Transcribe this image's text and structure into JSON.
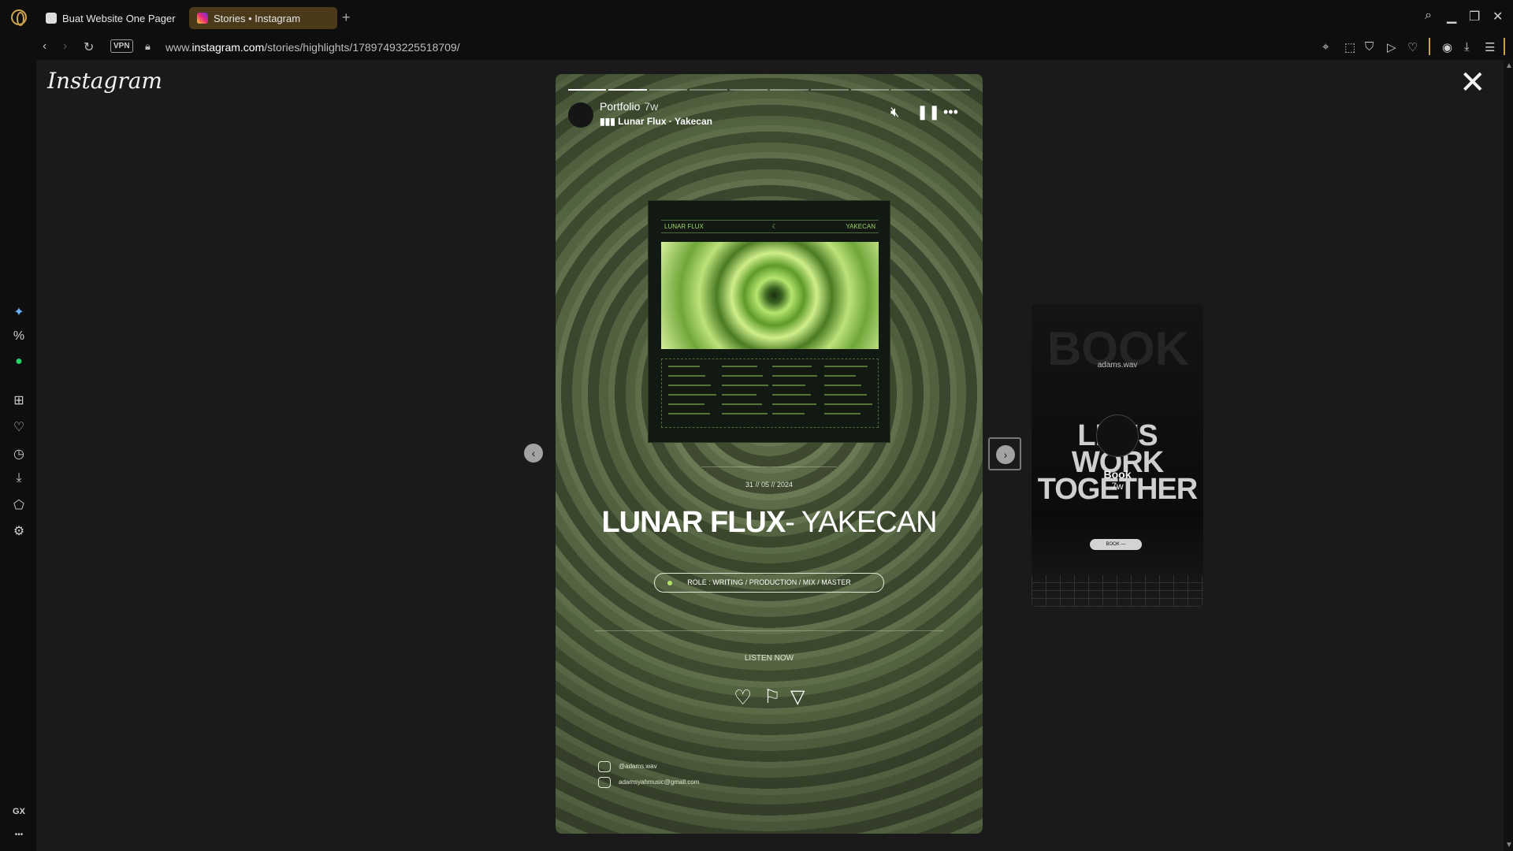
{
  "browser": {
    "tabs": [
      {
        "label": "Buat Website One Pager"
      },
      {
        "label": "Stories • Instagram"
      }
    ],
    "new_tab": "+",
    "vpn_label": "VPN",
    "url_prefix": "www.",
    "url_host": "instagram.com",
    "url_path": "/stories/highlights/17897493225518709/",
    "sidebar_bottom_label": "GX",
    "sidebar_more": "•••"
  },
  "instagram": {
    "logo": "Instagram",
    "close": "✕"
  },
  "story": {
    "segments_total": 10,
    "segments_done": 2,
    "username": "Portfolio",
    "time": "7w",
    "song": "Lunar Flux · Yakecan",
    "card_header_left": "LUNAR FLUX",
    "card_header_right": "YAKECAN",
    "date": "31 // 05 // 2024",
    "title_bold": "LUNAR FLUX",
    "title_rest": "- YAKECAN",
    "role": "ROLE : WRITING / PRODUCTION / MIX / MASTER",
    "listen": "LISTEN NOW",
    "social_handle": "@adams.wav",
    "social_email": "adamsyahmusic@gmail.com"
  },
  "preview": {
    "bg_word": "BOOK",
    "brand": "adams.wav",
    "headline_1": "LET'S WORK",
    "headline_2": "TOGETHER",
    "username": "Book",
    "time": "7w",
    "button": "BOOK —"
  },
  "colors": {
    "accent": "#c9a24b",
    "story_green": "#4e5b3d",
    "lime": "#b7e36a"
  }
}
